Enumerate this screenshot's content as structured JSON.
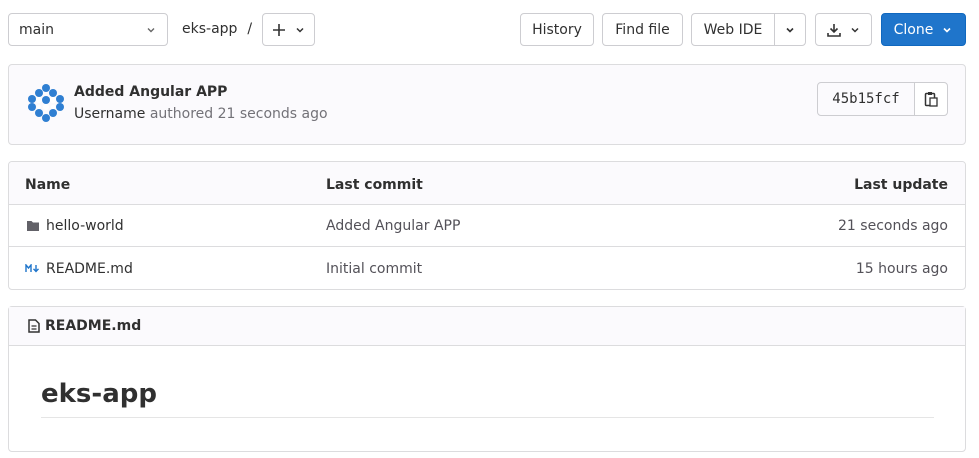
{
  "toolbar": {
    "branch": "main",
    "repo": "eks-app",
    "separator": "/",
    "history": "History",
    "find_file": "Find file",
    "web_ide": "Web IDE",
    "clone": "Clone"
  },
  "commit": {
    "title": "Added Angular APP",
    "author": "Username",
    "authored": "authored",
    "time": "21 seconds ago",
    "sha": "45b15fcf"
  },
  "table": {
    "headers": {
      "name": "Name",
      "last_commit": "Last commit",
      "last_update": "Last update"
    },
    "rows": [
      {
        "icon": "folder-icon",
        "name": "hello-world",
        "commit": "Added Angular APP",
        "updated": "21 seconds ago"
      },
      {
        "icon": "markdown-icon",
        "name": "README.md",
        "commit": "Initial commit",
        "updated": "15 hours ago"
      }
    ]
  },
  "readme": {
    "file": "README.md",
    "heading": "eks-app"
  },
  "colors": {
    "primary": "#1f75cb",
    "border": "#dcdcde",
    "panel": "#fbfafd"
  }
}
